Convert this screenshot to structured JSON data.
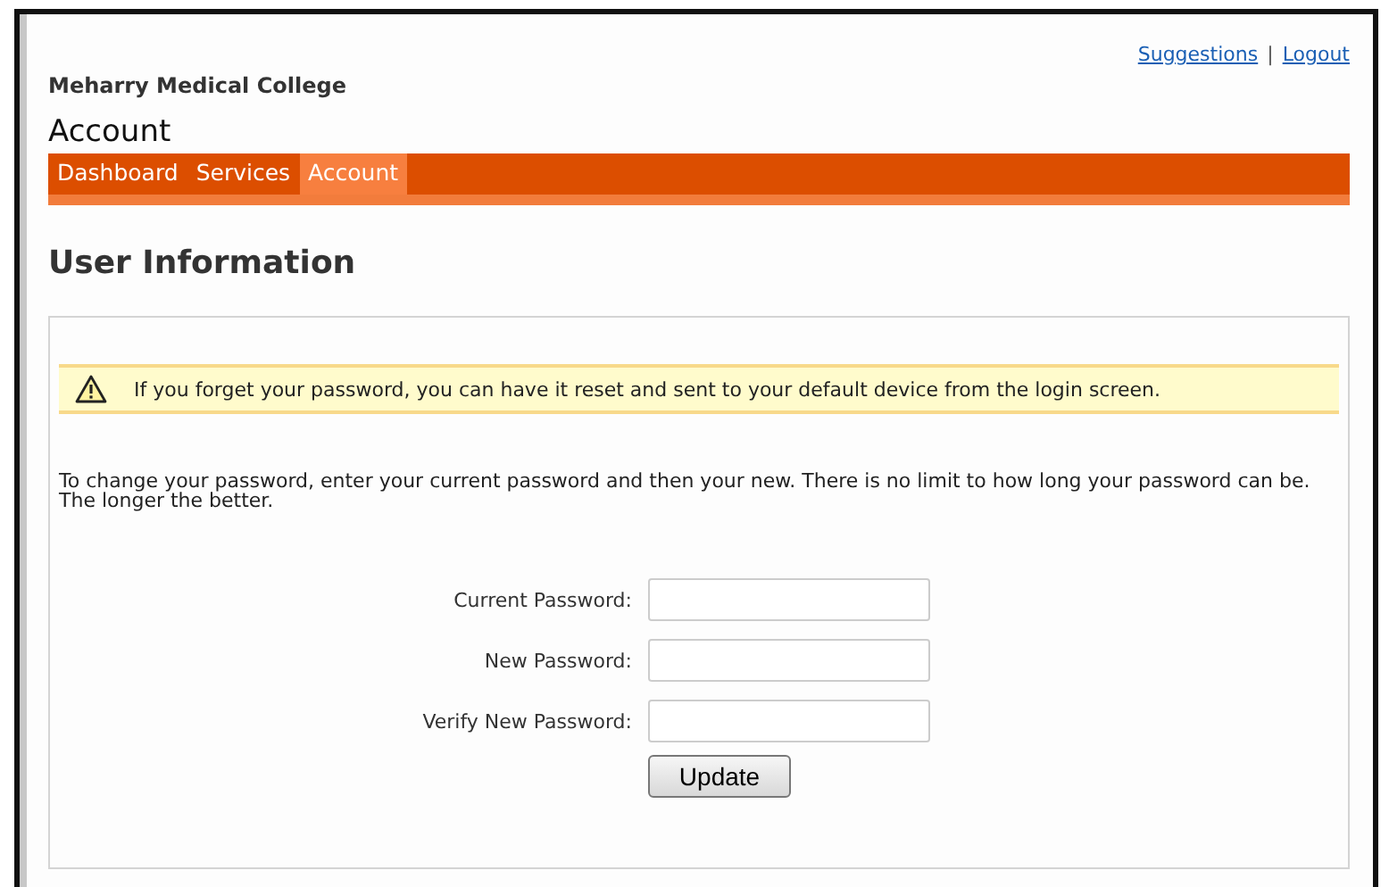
{
  "top_links": [
    "Suggestions",
    "Logout"
  ],
  "top_links_separator": "|",
  "organization": "Meharry Medical College",
  "page_title": "Account",
  "nav_tabs": [
    {
      "label": "Dashboard",
      "selected": false
    },
    {
      "label": "Services",
      "selected": false
    },
    {
      "label": "Account",
      "selected": true
    }
  ],
  "section_title": "User Information",
  "alert": {
    "text": "If you forget your password, you can have it reset and sent to your default device from the login screen."
  },
  "instructions": "To change your password, enter your current password and then your new. There is no limit to how long your password can be. The longer the better.",
  "form_fields": [
    {
      "label": "Current Password:"
    },
    {
      "label": "New Password:"
    },
    {
      "label": "Verify New Password:"
    }
  ],
  "submit_button": "Update"
}
